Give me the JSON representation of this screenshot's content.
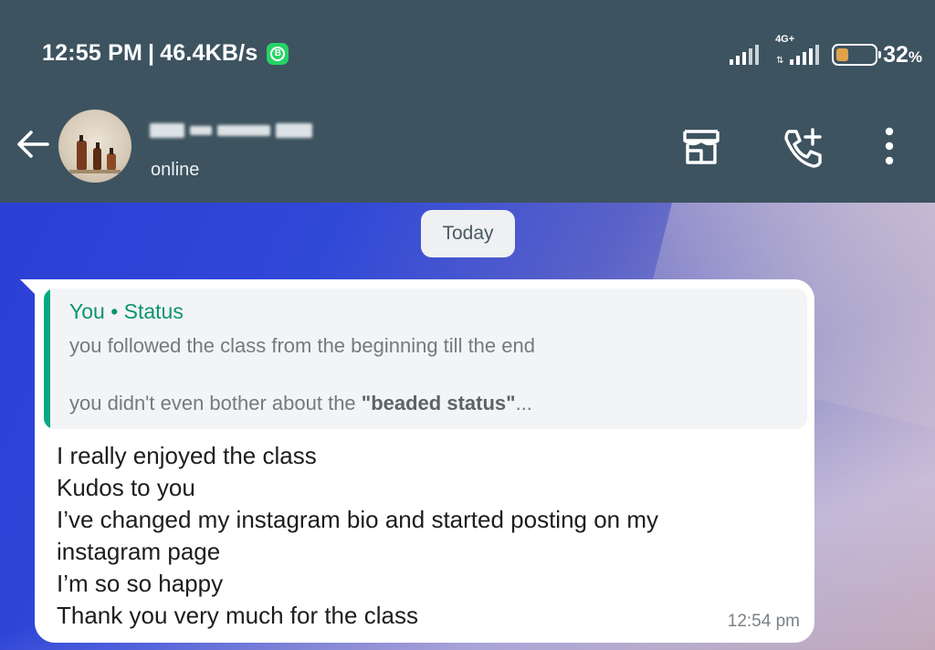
{
  "status_bar": {
    "time": "12:55 PM",
    "separator": "|",
    "speed": "46.4KB/s",
    "app_badge": "B",
    "network_type": "4G+",
    "transfer_arrows": "⇅",
    "battery_level": 0.32,
    "battery_percent": "32",
    "battery_unit": "%"
  },
  "header": {
    "contact_name_visible": "",
    "contact_status": "online",
    "icons": [
      "back-arrow-icon",
      "storefront-icon",
      "add-call-icon",
      "more-vert-icon"
    ]
  },
  "chat": {
    "date_chip": "Today",
    "message": {
      "quote": {
        "title": "You • Status",
        "line1": "you followed the class from the beginning till the end",
        "line2_prefix": "you didn't even bother about the ",
        "line2_bold": "\"beaded status\"",
        "line2_suffix": "..."
      },
      "lines": [
        "I really enjoyed the class",
        "Kudos to you",
        "I’ve changed my instagram bio and  started posting on my",
        "instagram page",
        "I’m so so happy",
        "Thank you very much for the class"
      ],
      "time": "12:54 pm"
    }
  },
  "colors": {
    "header_bg": "#3d5360",
    "quote_accent": "#06a883",
    "quote_title": "#07956f",
    "battery_fill": "#e0a24a",
    "whatsapp_green": "#25d366"
  }
}
